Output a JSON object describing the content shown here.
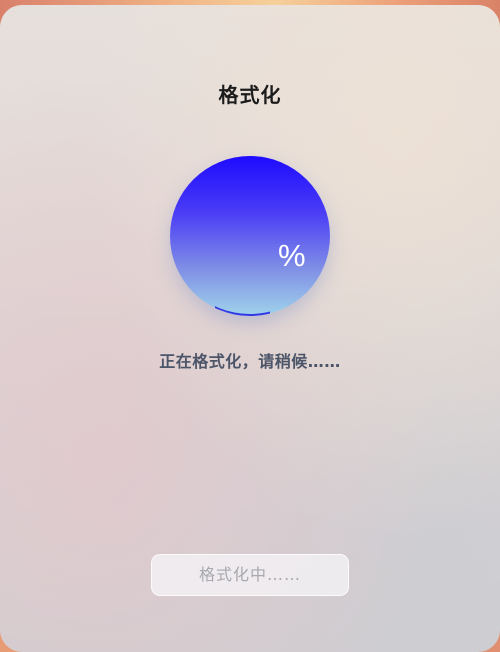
{
  "dialog": {
    "title": "格式化",
    "progress_percent_symbol": "%",
    "progress_value": null,
    "status_text": "正在格式化，请稍候……",
    "button_label": "格式化中……"
  },
  "colors": {
    "circle_top": "#1e0bff",
    "circle_bottom": "#9fd3ea",
    "title": "#1c1c1c",
    "status": "#4c5568",
    "button_text": "#a7a9ae"
  }
}
